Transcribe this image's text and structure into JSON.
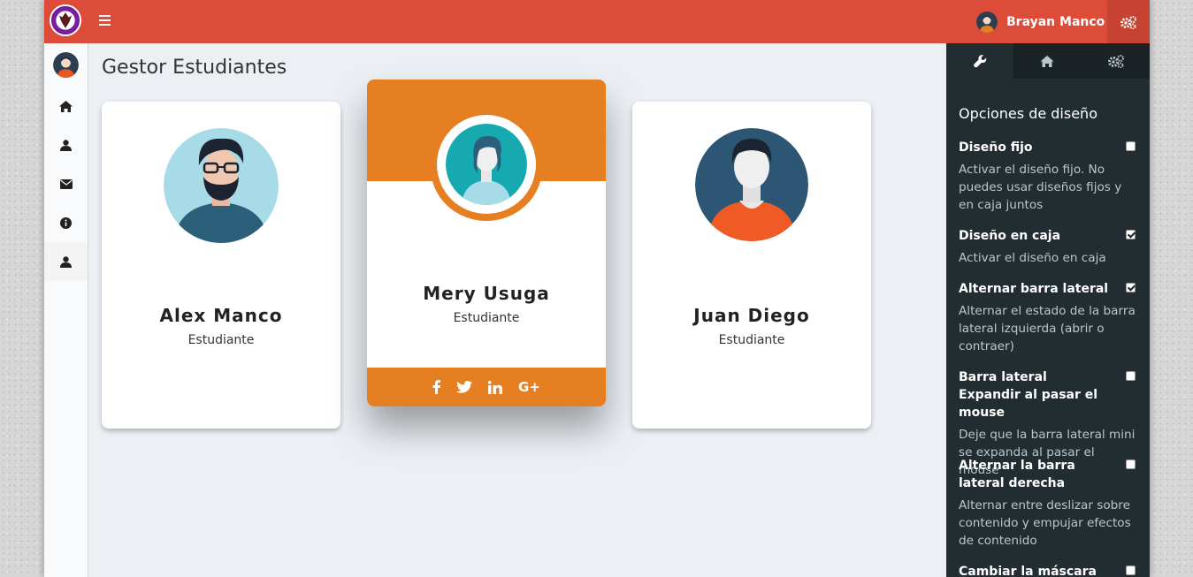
{
  "header": {
    "user_name": "Brayan Manco",
    "brand_color": "#dd4b39"
  },
  "sidebar": {
    "items": [
      {
        "icon": "home-icon"
      },
      {
        "icon": "user-icon"
      },
      {
        "icon": "envelope-icon"
      },
      {
        "icon": "info-icon"
      },
      {
        "icon": "user-icon"
      }
    ]
  },
  "main": {
    "title": "Gestor Estudiantes",
    "cards": [
      {
        "name": "Alex Manco",
        "role": "Estudiante"
      },
      {
        "name": "Mery Usuga",
        "role": "Estudiante",
        "accent": "#e67e22",
        "social": [
          "facebook",
          "twitter",
          "linkedin",
          "G+"
        ]
      },
      {
        "name": "Juan Diego",
        "role": "Estudiante"
      }
    ]
  },
  "control_sidebar": {
    "tabs": [
      "wrench-icon",
      "home-icon",
      "gears-icon"
    ],
    "heading": "Opciones de diseño",
    "options": [
      {
        "label": "Diseño fijo",
        "desc": "Activar el diseño fijo. No puedes usar diseños fijos y en caja juntos",
        "checked": false
      },
      {
        "label": "Diseño en caja",
        "desc": "Activar el diseño en caja",
        "checked": true
      },
      {
        "label": "Alternar barra lateral",
        "desc": "Alternar el estado de la barra lateral izquierda (abrir o contraer)",
        "checked": true
      },
      {
        "label": "Barra lateral Expandir al pasar el mouse",
        "desc": "Deje que la barra lateral mini se expanda al pasar el mouse",
        "checked": false
      },
      {
        "label": "Alternar la barra lateral derecha",
        "desc": "Alternar entre deslizar sobre contenido y empujar efectos de contenido",
        "checked": false
      },
      {
        "label": "Cambiar la máscara de la",
        "desc": "",
        "checked": false
      }
    ]
  }
}
